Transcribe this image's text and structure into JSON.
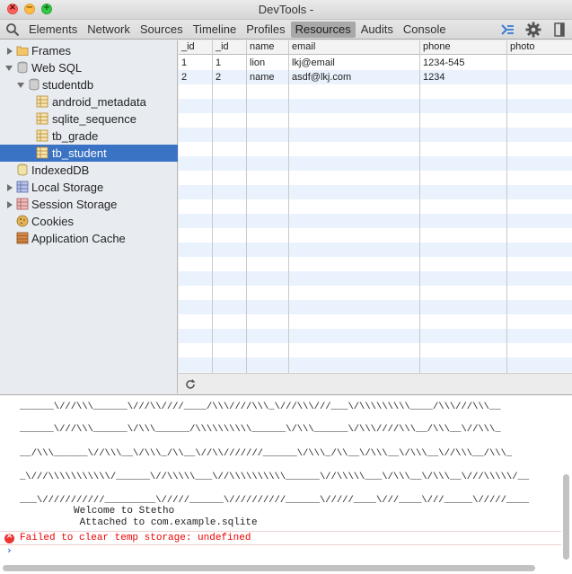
{
  "window": {
    "title": "DevTools -"
  },
  "toolbar": {
    "tabs": [
      {
        "label": "Elements"
      },
      {
        "label": "Network"
      },
      {
        "label": "Sources"
      },
      {
        "label": "Timeline"
      },
      {
        "label": "Profiles"
      },
      {
        "label": "Resources",
        "active": true
      },
      {
        "label": "Audits"
      },
      {
        "label": "Console"
      }
    ],
    "icons": [
      "search-icon",
      "console-drawer-icon",
      "settings-gear-icon",
      "dock-icon"
    ]
  },
  "sidebar": {
    "items": [
      {
        "label": "Frames",
        "expanded": false,
        "icon": "folder-icon"
      },
      {
        "label": "Web SQL",
        "expanded": true,
        "icon": "database-icon"
      },
      {
        "label": "studentdb",
        "expanded": true,
        "icon": "database-icon"
      },
      {
        "label": "android_metadata",
        "icon": "table-icon"
      },
      {
        "label": "sqlite_sequence",
        "icon": "table-icon"
      },
      {
        "label": "tb_grade",
        "icon": "table-icon"
      },
      {
        "label": "tb_student",
        "icon": "table-icon",
        "selected": true
      },
      {
        "label": "IndexedDB",
        "icon": "database-icon"
      },
      {
        "label": "Local Storage",
        "expanded": false,
        "icon": "local-storage-icon"
      },
      {
        "label": "Session Storage",
        "expanded": false,
        "icon": "session-storage-icon"
      },
      {
        "label": "Cookies",
        "icon": "cookie-icon"
      },
      {
        "label": "Application Cache",
        "icon": "app-cache-icon"
      }
    ]
  },
  "table": {
    "columns": [
      "_id",
      "_id",
      "name",
      "email",
      "phone",
      "photo"
    ],
    "rows": [
      [
        "1",
        "1",
        "lion",
        "lkj@email",
        "1234-545",
        ""
      ],
      [
        "2",
        "2",
        "name",
        "asdf@lkj.com",
        "1234",
        ""
      ]
    ]
  },
  "console": {
    "ascii_lines": [
      "______\\///\\\\\\______\\///\\\\////____/\\\\\\////\\\\\\_\\///\\\\\\///___\\/\\\\\\\\\\\\\\\\\\____/\\\\\\///\\\\\\__",
      "______\\///\\\\\\______\\/\\\\\\______/\\\\\\\\\\\\\\\\\\\\______\\/\\\\\\______\\/\\\\\\////\\\\\\__/\\\\\\__\\//\\\\\\_",
      "__/\\\\\\______\\//\\\\\\__\\/\\\\\\_/\\\\__\\//\\\\///////______\\/\\\\\\_/\\\\__\\/\\\\\\__\\/\\\\\\__\\//\\\\\\__/\\\\\\_",
      "_\\///\\\\\\\\\\\\\\\\\\\\\\/______\\//\\\\\\\\\\___\\//\\\\\\\\\\\\\\\\\\\\______\\//\\\\\\\\\\___\\/\\\\\\__\\/\\\\\\__\\///\\\\\\\\\\/__",
      "___\\///////////_________\\/////______\\//////////______\\/////____\\///____\\///_____\\/////____"
    ],
    "messages": [
      "Welcome to Stetho",
      " Attached to com.example.sqlite"
    ],
    "error": "Failed to clear temp storage: undefined",
    "error_icon": "error-icon",
    "prompt_icon": "prompt-chevron-icon"
  },
  "colors": {
    "selected_row": "#3a72c4",
    "stripe": "#eaf3fd",
    "error_text": "#ee0000",
    "prompt": "#2b6fd6"
  }
}
